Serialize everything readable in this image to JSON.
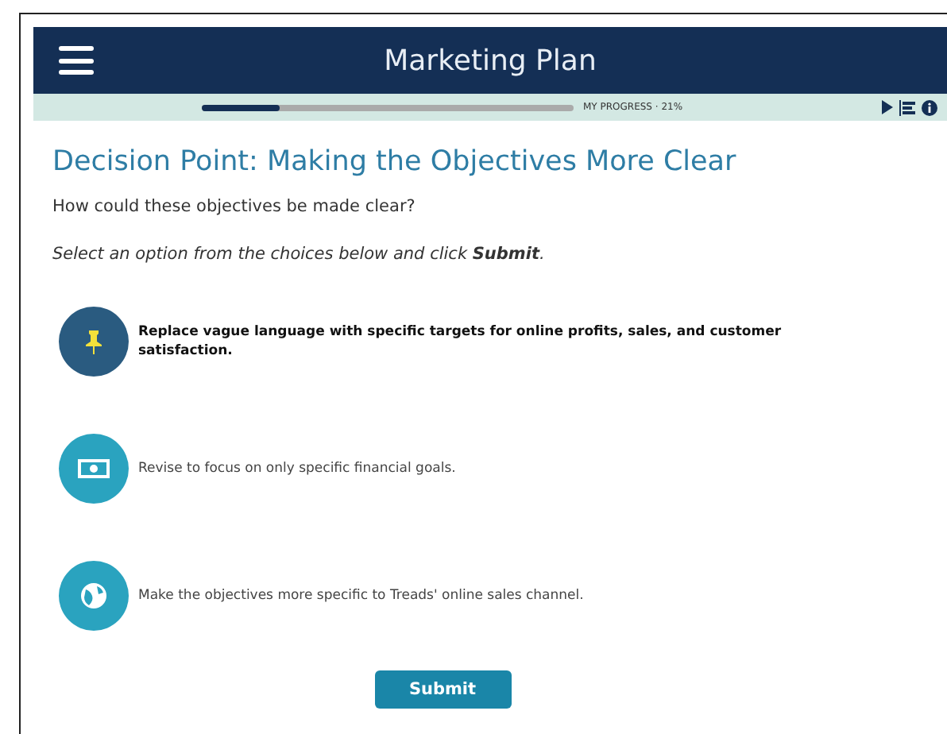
{
  "header": {
    "title": "Marketing Plan"
  },
  "progress": {
    "level": 0.21,
    "label": "MY PROGRESS · 21%"
  },
  "heading": "Decision Point: Making the Objectives More Clear",
  "question": "How could these objectives be made clear?",
  "instruction": "Select an option from the choices below and click **Submit**.",
  "options": [
    {
      "kind": "pin",
      "text": "Replace vague language with specific targets for online profits, sales, and customer satisfaction.",
      "selected": true
    },
    {
      "kind": "money",
      "text": "Revise to focus on only specific financial goals.",
      "selected": false
    },
    {
      "kind": "globe",
      "text": "Make the objectives more specific to Treads' online sales channel.",
      "selected": false
    }
  ],
  "submit": "Submit"
}
